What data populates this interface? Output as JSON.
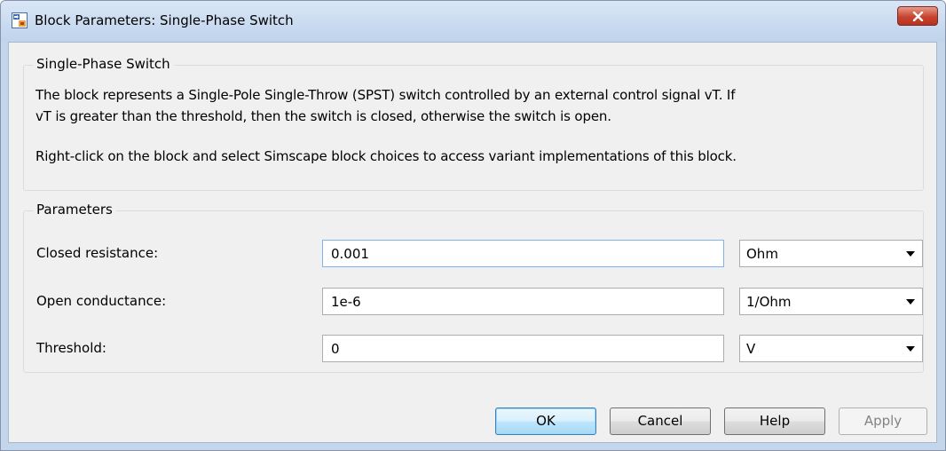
{
  "window": {
    "title": "Block Parameters: Single-Phase Switch",
    "close_icon": "close-x-icon",
    "app_icon": "simulink-block-icon"
  },
  "description": {
    "group_title": "Single-Phase Switch",
    "line1": "The block represents a Single-Pole Single-Throw (SPST) switch controlled by an external control signal vT. If",
    "line2": "vT is greater than the threshold, then the switch is closed, otherwise the switch is open.",
    "line3": "Right-click on the block and select Simscape block choices to access variant implementations of this block."
  },
  "parameters": {
    "group_title": "Parameters",
    "rows": [
      {
        "label": "Closed resistance:",
        "value": "0.001",
        "unit": "Ohm"
      },
      {
        "label": "Open conductance:",
        "value": "1e-6",
        "unit": "1/Ohm"
      },
      {
        "label": "Threshold:",
        "value": "0",
        "unit": "V"
      }
    ]
  },
  "buttons": {
    "ok": "OK",
    "cancel": "Cancel",
    "help": "Help",
    "apply": "Apply"
  },
  "colors": {
    "title_bar": "#c4d6ec",
    "close_button": "#c7442f",
    "dialog_background": "#f0f0f0",
    "default_button_accent": "#3c7fb1",
    "disabled_text": "#838383"
  }
}
